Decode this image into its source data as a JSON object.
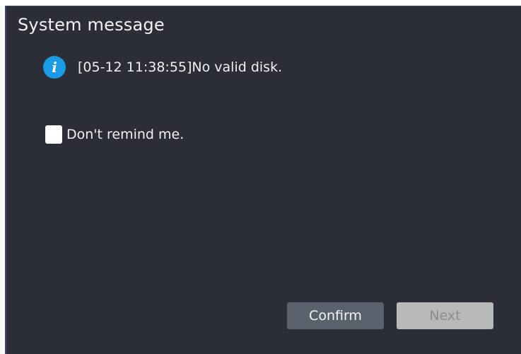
{
  "dialog": {
    "title": "System message",
    "message": "[05-12 11:38:55]No valid disk.",
    "info_icon": "info-icon",
    "remind_label": "Don't remind me.",
    "remind_checked": false,
    "buttons": {
      "confirm_label": "Confirm",
      "next_label": "Next",
      "next_enabled": false
    }
  }
}
